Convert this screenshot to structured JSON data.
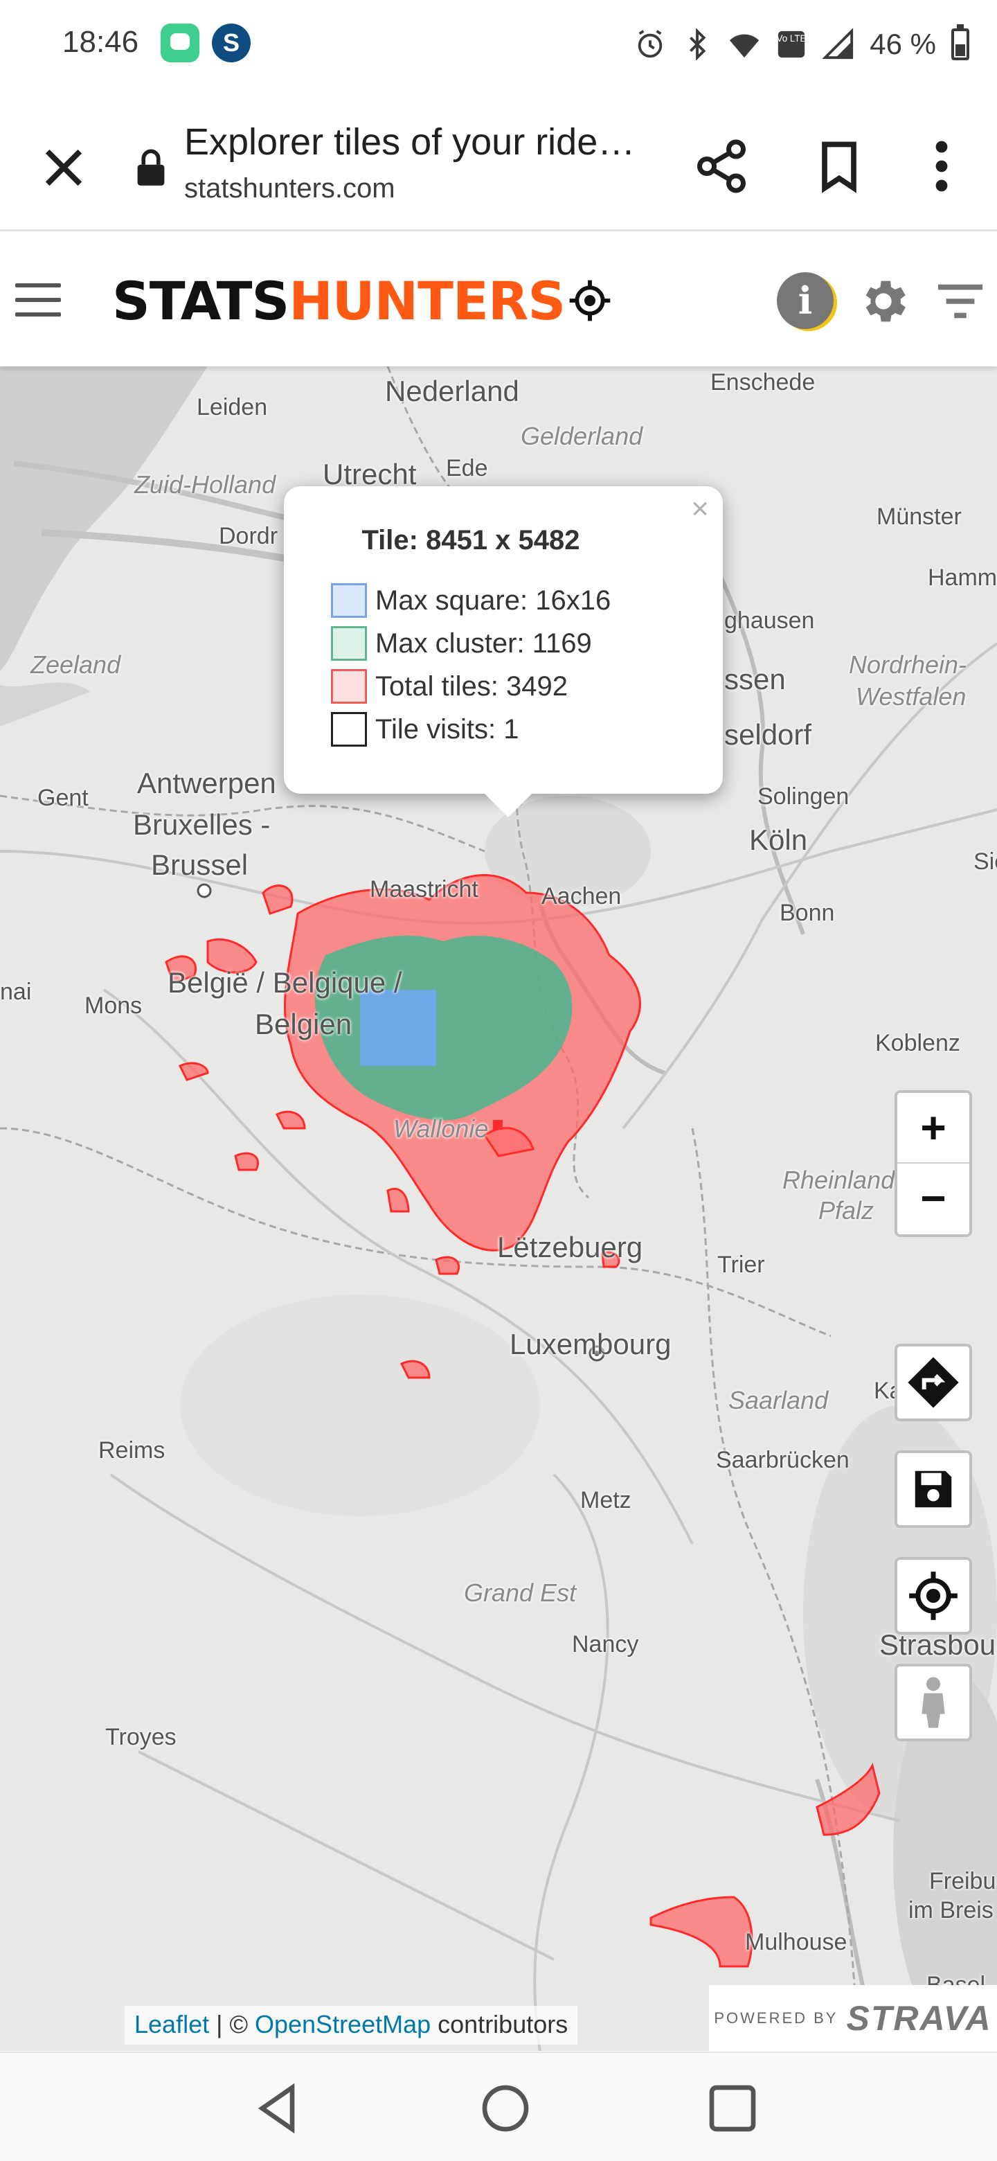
{
  "status_bar": {
    "time": "18:46",
    "notification_icons": [
      "chat-bubble-icon",
      "s-app-icon"
    ],
    "s_app_letter": "S",
    "right_icons": [
      "alarm-icon",
      "bluetooth-icon",
      "wifi-icon",
      "volte-icon",
      "signal-icon"
    ],
    "volte_label": "Vo LTE",
    "battery_percent": "46 %"
  },
  "browser_tab": {
    "title": "Explorer tiles of your ride…",
    "url": "statshunters.com"
  },
  "header": {
    "logo_part1": "STATS",
    "logo_part2": "HUNTERS",
    "info_label": "i",
    "colors": {
      "logo_orange": "#ff5a14",
      "info_ring": "#f2c318"
    }
  },
  "map": {
    "places": [
      {
        "name": "Leiden"
      },
      {
        "name": "Nederland"
      },
      {
        "name": "Gelderland"
      },
      {
        "name": "Enschede"
      },
      {
        "name": "Zuid-Holland"
      },
      {
        "name": "Utrecht"
      },
      {
        "name": "Ede"
      },
      {
        "name": "Dordr"
      },
      {
        "name": "Münster"
      },
      {
        "name": "Hamm"
      },
      {
        "name": "Zeeland"
      },
      {
        "name": "ghausen"
      },
      {
        "name": "ssen"
      },
      {
        "name": "Nordrhein-"
      },
      {
        "name": "Westfalen"
      },
      {
        "name": "seldorf"
      },
      {
        "name": "Gent"
      },
      {
        "name": "Antwerpen"
      },
      {
        "name": "Solingen"
      },
      {
        "name": "Bruxelles -"
      },
      {
        "name": "Brussel"
      },
      {
        "name": "Köln"
      },
      {
        "name": "Sie"
      },
      {
        "name": "Maastricht"
      },
      {
        "name": "Aachen"
      },
      {
        "name": "Bonn"
      },
      {
        "name": "België / Belgique /"
      },
      {
        "name": "Belgien"
      },
      {
        "name": "Mons"
      },
      {
        "name": "nai"
      },
      {
        "name": "Koblenz"
      },
      {
        "name": "Wallonie"
      },
      {
        "name": "Rheinland-"
      },
      {
        "name": "Pfalz"
      },
      {
        "name": "Lëtzebuerg"
      },
      {
        "name": "Trier"
      },
      {
        "name": "Luxembourg"
      },
      {
        "name": "Saarland"
      },
      {
        "name": "Ka"
      },
      {
        "name": "Reims"
      },
      {
        "name": "Saarbrücken"
      },
      {
        "name": "Metz"
      },
      {
        "name": "Grand Est"
      },
      {
        "name": "Nancy"
      },
      {
        "name": "Strasbou"
      },
      {
        "name": "Troyes"
      },
      {
        "name": "Freibu"
      },
      {
        "name": "im Breis"
      },
      {
        "name": "Mulhouse"
      },
      {
        "name": "Basel"
      }
    ],
    "tile_colors": {
      "max_square": "#6fa8f0",
      "max_cluster": "#4db890",
      "total": "#ff2a2a"
    }
  },
  "popup": {
    "close": "×",
    "title": "Tile: 8451 x 5482",
    "legend": [
      {
        "label": "Max square: 16x16",
        "fill": "#dce8fb",
        "border": "#7aa3e6"
      },
      {
        "label": "Max cluster: 1169",
        "fill": "#dff2e9",
        "border": "#5fb58e"
      },
      {
        "label": "Total tiles: 3492",
        "fill": "#fde1e1",
        "border": "#ef5a5a"
      },
      {
        "label": "Tile visits: 1",
        "fill": "#ffffff",
        "border": "#222222"
      }
    ]
  },
  "controls": {
    "zoom_in": "+",
    "zoom_out": "−"
  },
  "attribution": {
    "leaflet": "Leaflet",
    "separator": " | © ",
    "osm": "OpenStreetMap",
    "suffix": " contributors"
  },
  "strava_badge": {
    "powered_by": "POWERED BY",
    "brand": "STRAVA"
  }
}
